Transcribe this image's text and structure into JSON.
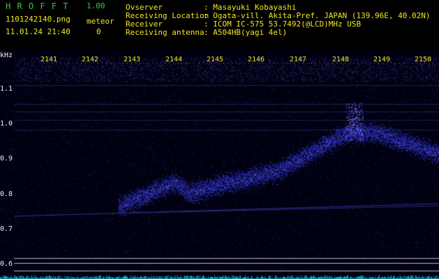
{
  "app": {
    "name": "H R O F F T",
    "version": "1.00"
  },
  "file": {
    "name": "1101242140.png",
    "datetime": "11.01.24 21:40"
  },
  "meteor": {
    "label": "meteor",
    "count": "0"
  },
  "info": [
    {
      "key": "Ovserver",
      "value": ": Masayuki Kobayashi"
    },
    {
      "key": "Receiving Location",
      "value": ": Ogata-vill. Akita-Pref. JAPAN (139.96E, 40.02N)"
    },
    {
      "key": "Receiver",
      "value": ": ICOM IC-575 53.7492(@LCD)MHz USB"
    },
    {
      "key": "Receiving antenna",
      "value": ": A504HB(yagi 4el)"
    }
  ],
  "axis": {
    "unit": "kHz",
    "y_ticks": [
      "1.1",
      "1.0",
      "0.9",
      "0.8",
      "0.7",
      "0.6"
    ],
    "x_ticks": [
      "2141",
      "2142",
      "2143",
      "2144",
      "2145",
      "2146",
      "2147",
      "2148",
      "2149",
      "2150"
    ]
  },
  "colors": {
    "text_green": "#39c839",
    "text_yellow": "#f2e61f",
    "signal": "#3a3aff",
    "background": "#000010"
  }
}
